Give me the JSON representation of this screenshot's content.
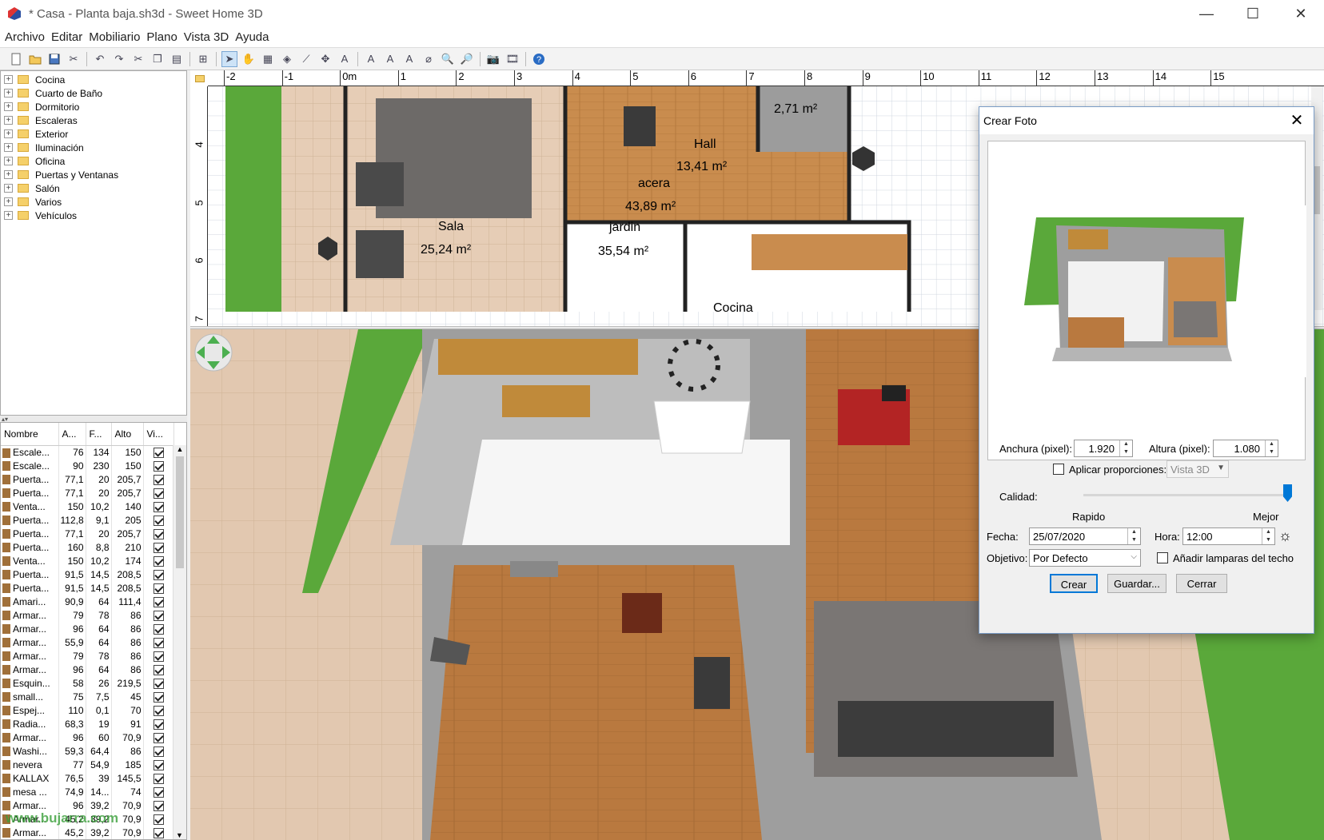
{
  "window": {
    "title": "* Casa - Planta baja.sh3d - Sweet Home 3D",
    "minimize": "—",
    "maximize": "☐",
    "close": "✕"
  },
  "menu": [
    "Archivo",
    "Editar",
    "Mobiliario",
    "Plano",
    "Vista 3D",
    "Ayuda"
  ],
  "toolbar_icons": [
    "new-icon",
    "open-icon",
    "save-icon",
    "cut-icon",
    "undo-icon",
    "redo-icon",
    "cut2-icon",
    "copy-icon",
    "paste-icon",
    "add-furniture-icon",
    "select-icon",
    "pan-icon",
    "create-walls-icon",
    "create-rooms-icon",
    "create-polylines-icon",
    "create-dimensions-icon",
    "add-text-icon",
    "text-style-icon",
    "bold-icon",
    "italic-icon",
    "zoom-in-icon",
    "zoom-out-icon",
    "create-photo-icon",
    "create-video-icon",
    "help-icon"
  ],
  "catalog": [
    "Cocina",
    "Cuarto de Baño",
    "Dormitorio",
    "Escaleras",
    "Exterior",
    "Iluminación",
    "Oficina",
    "Puertas y Ventanas",
    "Salón",
    "Varios",
    "Vehículos"
  ],
  "furniture": {
    "headers": [
      "Nombre",
      "A...",
      "F...",
      "Alto",
      "Vi..."
    ],
    "rows": [
      [
        "Escale...",
        "76",
        "134",
        "150"
      ],
      [
        "Escale...",
        "90",
        "230",
        "150"
      ],
      [
        "Puerta...",
        "77,1",
        "20",
        "205,7"
      ],
      [
        "Puerta...",
        "77,1",
        "20",
        "205,7"
      ],
      [
        "Venta...",
        "150",
        "10,2",
        "140"
      ],
      [
        "Puerta...",
        "112,8",
        "9,1",
        "205"
      ],
      [
        "Puerta...",
        "77,1",
        "20",
        "205,7"
      ],
      [
        "Puerta...",
        "160",
        "8,8",
        "210"
      ],
      [
        "Venta...",
        "150",
        "10,2",
        "174"
      ],
      [
        "Puerta...",
        "91,5",
        "14,5",
        "208,5"
      ],
      [
        "Puerta...",
        "91,5",
        "14,5",
        "208,5"
      ],
      [
        "Amari...",
        "90,9",
        "64",
        "111,4"
      ],
      [
        "Armar...",
        "79",
        "78",
        "86"
      ],
      [
        "Armar...",
        "96",
        "64",
        "86"
      ],
      [
        "Armar...",
        "55,9",
        "64",
        "86"
      ],
      [
        "Armar...",
        "79",
        "78",
        "86"
      ],
      [
        "Armar...",
        "96",
        "64",
        "86"
      ],
      [
        "Esquin...",
        "58",
        "26",
        "219,5"
      ],
      [
        "small...",
        "75",
        "7,5",
        "45"
      ],
      [
        "Espej...",
        "110",
        "0,1",
        "70"
      ],
      [
        "Radia...",
        "68,3",
        "19",
        "91"
      ],
      [
        "Armar...",
        "96",
        "60",
        "70,9"
      ],
      [
        "Washi...",
        "59,3",
        "64,4",
        "86"
      ],
      [
        "nevera",
        "77",
        "54,9",
        "185"
      ],
      [
        "KALLAX",
        "76,5",
        "39",
        "145,5"
      ],
      [
        "mesa ...",
        "74,9",
        "14...",
        "74"
      ],
      [
        "Armar...",
        "96",
        "39,2",
        "70,9"
      ],
      [
        "Armar...",
        "45,2",
        "39,2",
        "70,9"
      ],
      [
        "Armar...",
        "45,2",
        "39,2",
        "70,9"
      ]
    ]
  },
  "plan": {
    "ruler_x": [
      "-2",
      "-1",
      "0m",
      "1",
      "2",
      "3",
      "4",
      "5",
      "6",
      "7",
      "8",
      "9",
      "10",
      "11",
      "12",
      "13",
      "14",
      "15"
    ],
    "ruler_y": [
      "4",
      "5",
      "6",
      "7"
    ],
    "rooms": [
      {
        "name": "Sala",
        "area": "25,24 m²"
      },
      {
        "name": "Hall",
        "area": "13,41 m²"
      },
      {
        "name": "acera",
        "area": "43,89 m²"
      },
      {
        "name": "jardin",
        "area": "35,54 m²"
      },
      {
        "name": "",
        "area": "2,71 m²"
      },
      {
        "name": "Cocina",
        "area": ""
      }
    ]
  },
  "dialog": {
    "title": "Crear Foto",
    "width_label": "Anchura (pixel):",
    "width_value": "1.920",
    "height_label": "Altura (pixel):",
    "height_value": "1.080",
    "proportions_label": "Aplicar proporciones:",
    "proportions_value": "Vista 3D",
    "quality_label": "Calidad:",
    "quality_min": "Rapido",
    "quality_max": "Mejor",
    "quality_level": 1.0,
    "date_label": "Fecha:",
    "date_value": "25/07/2020",
    "time_label": "Hora:",
    "time_value": "12:00",
    "lens_label": "Objetivo:",
    "lens_value": "Por Defecto",
    "ceiling_label": "Añadir lamparas del techo",
    "buttons": {
      "create": "Crear",
      "save": "Guardar...",
      "close": "Cerrar"
    }
  },
  "watermark": "www.bujarra.com",
  "colors": {
    "grass": "#5aa83a",
    "wood": "#c98c4e",
    "tile": "#e3cbb5",
    "accent": "#0078d7"
  }
}
